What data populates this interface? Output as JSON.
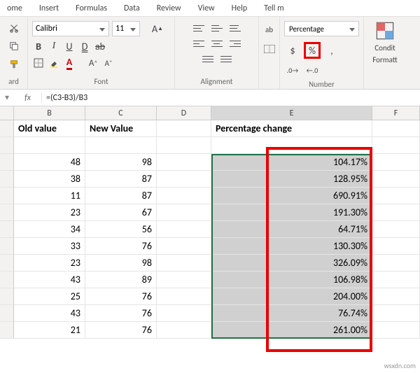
{
  "tabs": {
    "home_partial": "ome",
    "insert": "Insert",
    "formulas": "Formulas",
    "data": "Data",
    "review": "Review",
    "view": "View",
    "help": "Help",
    "tellme": "Tell m"
  },
  "font": {
    "name": "Calibri",
    "size": "11"
  },
  "number": {
    "format": "Percentage",
    "dollar": "$",
    "percent": "%",
    "comma": ","
  },
  "cond": {
    "line1": "Condit",
    "line2": "Formatt"
  },
  "groups": {
    "clipboard": "ard",
    "font": "Font",
    "alignment": "Alignment",
    "number": "Number"
  },
  "font_buttons": {
    "B": "B",
    "I": "I",
    "U": "U",
    "D": "D",
    "ab": "ab"
  },
  "formula": {
    "fx": "fx",
    "value": "=(C3-B3)/B3"
  },
  "columns": {
    "B": "B",
    "C": "C",
    "D": "D",
    "E": "E",
    "F": "F"
  },
  "headers": {
    "old": "Old value",
    "new": "New Value",
    "pct": "Percentage change"
  },
  "rows": [
    {
      "old": "48",
      "new": "98",
      "pct": "104.17%"
    },
    {
      "old": "38",
      "new": "87",
      "pct": "128.95%"
    },
    {
      "old": "11",
      "new": "87",
      "pct": "690.91%"
    },
    {
      "old": "23",
      "new": "67",
      "pct": "191.30%"
    },
    {
      "old": "34",
      "new": "56",
      "pct": "64.71%"
    },
    {
      "old": "33",
      "new": "76",
      "pct": "130.30%"
    },
    {
      "old": "23",
      "new": "98",
      "pct": "326.09%"
    },
    {
      "old": "43",
      "new": "89",
      "pct": "106.98%"
    },
    {
      "old": "25",
      "new": "76",
      "pct": "204.00%"
    },
    {
      "old": "43",
      "new": "76",
      "pct": "76.74%"
    },
    {
      "old": "21",
      "new": "76",
      "pct": "261.00%"
    }
  ],
  "watermark": "wsxdn.com"
}
